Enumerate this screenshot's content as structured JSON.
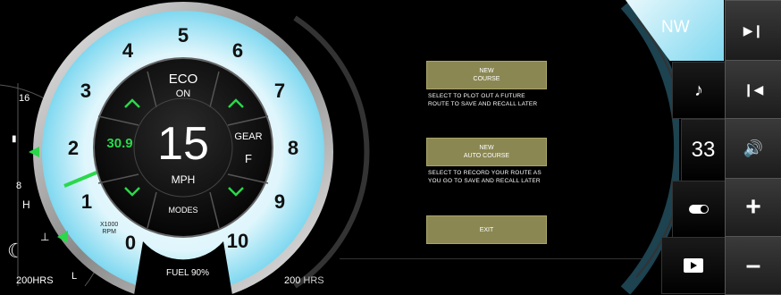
{
  "gauge": {
    "rpm_ticks": [
      "0",
      "1",
      "2",
      "3",
      "4",
      "5",
      "6",
      "7",
      "8",
      "9",
      "10"
    ],
    "rpm_unit": "X1000\nRPM",
    "speed": "15",
    "speed_unit": "MPH",
    "trim": "30.9",
    "eco_label": "ECO",
    "eco_state": "ON",
    "gear_label": "GEAR",
    "gear_value": "F",
    "modes_label": "MODES",
    "fuel": "FUEL 90%",
    "left_hours": "200HRS",
    "right_hours_value": "200",
    "right_hours_unit": "HRS"
  },
  "left_side": {
    "battery_high": "16",
    "battery_low": "8",
    "temp_high": "H",
    "temp_low": "L"
  },
  "menu": {
    "new_course_label": "NEW\nCOURSE",
    "new_course_desc": "SELECT TO PLOT OUT A FUTURE\nROUTE TO SAVE AND RECALL LATER",
    "new_auto_label": "NEW\nAUTO COURSE",
    "new_auto_desc": "SELECT TO RECORD YOUR ROUTE AS\nYOU GO TO SAVE AND RECALL LATER",
    "exit_label": "EXIT"
  },
  "right_panel": {
    "heading": "NW",
    "volume": "33"
  },
  "colors": {
    "accent": "#7fd8f0",
    "green": "#2ad84a",
    "button": "#8a8752"
  }
}
